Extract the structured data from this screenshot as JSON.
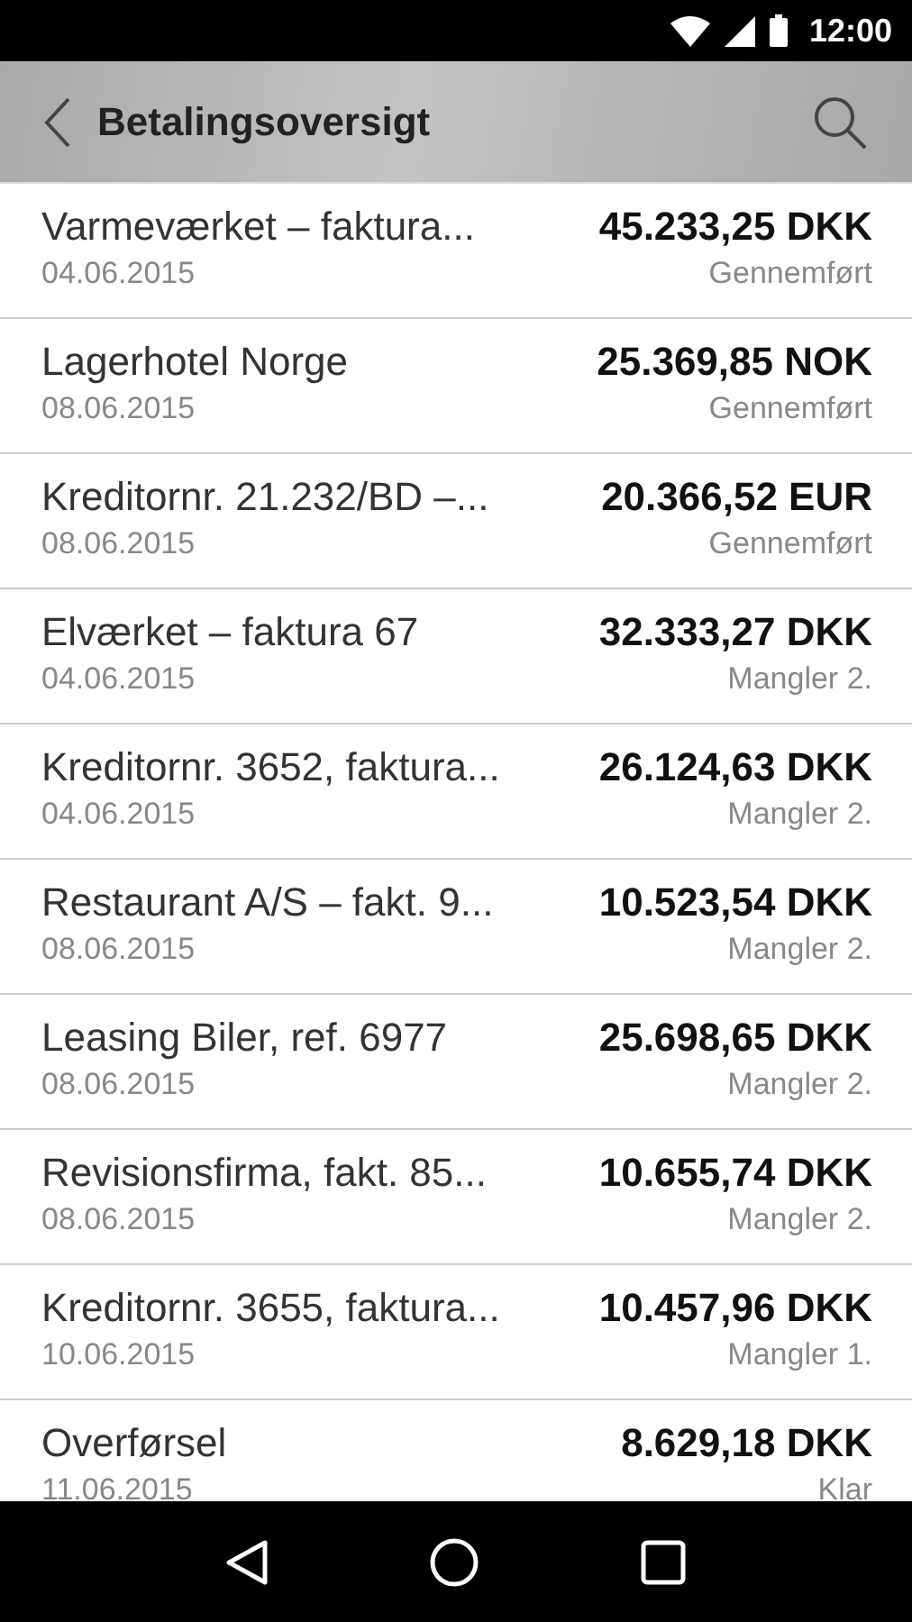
{
  "status_bar": {
    "time": "12:00"
  },
  "app_bar": {
    "title": "Betalingsoversigt"
  },
  "payments": [
    {
      "name": "Varmeværket – faktura...",
      "date": "04.06.2015",
      "amount": "45.233,25 DKK",
      "status": "Gennemført"
    },
    {
      "name": "Lagerhotel Norge",
      "date": "08.06.2015",
      "amount": "25.369,85 NOK",
      "status": "Gennemført"
    },
    {
      "name": "Kreditornr. 21.232/BD –...",
      "date": "08.06.2015",
      "amount": "20.366,52 EUR",
      "status": "Gennemført"
    },
    {
      "name": "Elværket – faktura 67",
      "date": "04.06.2015",
      "amount": "32.333,27 DKK",
      "status": "Mangler 2."
    },
    {
      "name": "Kreditornr. 3652, faktura...",
      "date": "04.06.2015",
      "amount": "26.124,63 DKK",
      "status": "Mangler 2."
    },
    {
      "name": "Restaurant A/S – fakt. 9...",
      "date": "08.06.2015",
      "amount": "10.523,54 DKK",
      "status": "Mangler 2."
    },
    {
      "name": "Leasing Biler, ref. 6977",
      "date": "08.06.2015",
      "amount": "25.698,65 DKK",
      "status": "Mangler 2."
    },
    {
      "name": "Revisionsfirma, fakt. 85...",
      "date": "08.06.2015",
      "amount": "10.655,74 DKK",
      "status": "Mangler 2."
    },
    {
      "name": "Kreditornr. 3655, faktura...",
      "date": "10.06.2015",
      "amount": "10.457,96 DKK",
      "status": "Mangler 1."
    },
    {
      "name": "Overførsel",
      "date": "11.06.2015",
      "amount": "8.629,18 DKK",
      "status": "Klar"
    }
  ]
}
